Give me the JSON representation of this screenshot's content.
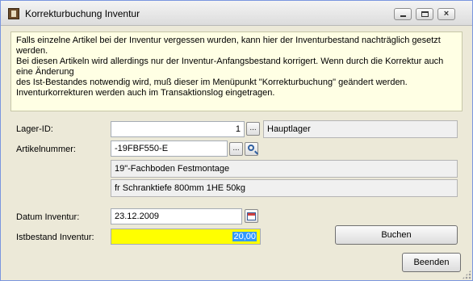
{
  "window": {
    "title": "Korrekturbuchung Inventur",
    "close_glyph": "×"
  },
  "info": {
    "lines": [
      "Falls einzelne Artikel bei der Inventur vergessen wurden, kann hier der Inventurbestand nachträglich gesetzt werden.",
      "Bei diesen Artikeln wird allerdings nur der Inventur-Anfangsbestand korrigert. Wenn durch die Korrektur auch eine Änderung",
      "des Ist-Bestandes notwendig wird, muß dieser im Menüpunkt \"Korrekturbuchung\" geändert werden.",
      "Inventurkorrekturen werden auch im Transaktionslog eingetragen."
    ]
  },
  "form": {
    "lager_label": "Lager-ID:",
    "lager_value": "1",
    "lager_name": "Hauptlager",
    "artikel_label": "Artikelnummer:",
    "artikel_value": "-19FBF550-E",
    "artikel_desc1": "19\"-Fachboden Festmontage",
    "artikel_desc2": "fr Schranktiefe 800mm 1HE 50kg",
    "datum_label": "Datum Inventur:",
    "datum_value": "23.12.2009",
    "istbestand_label": "Istbestand Inventur:",
    "istbestand_value": "20,00",
    "ellipsis": "..."
  },
  "buttons": {
    "buchen": "Buchen",
    "beenden": "Beenden"
  },
  "colors": {
    "info_bg": "#ffffe4",
    "highlight": "#ffff00",
    "selection": "#3399ff"
  }
}
